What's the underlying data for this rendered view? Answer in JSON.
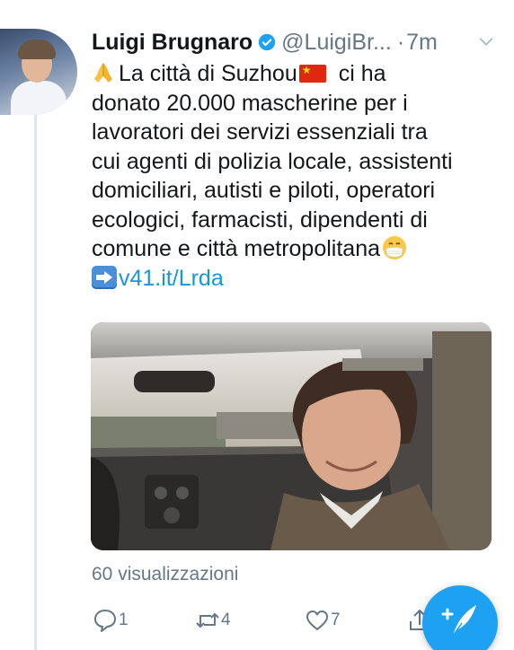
{
  "tweet": {
    "author_name": "Luigi Brugnaro",
    "author_handle": "@LuigiBr...",
    "separator": "·",
    "timestamp": "7m",
    "text_lines": [
      "La città di Suzhou",
      "ci ha",
      "donato 20.000 mascherine per i",
      "lavoratori dei servizi essenziali tra",
      "cui agenti di polizia locale, assistenti",
      "domiciliari, autisti e piloti, operatori",
      "ecologici, farmacisti, dipendenti di",
      "comune e città metropolitana"
    ],
    "link_text": "v41.it/Lrda",
    "views": "60 visualizzazioni"
  },
  "actions": {
    "reply_count": "1",
    "retweet_count": "4",
    "like_count": "7"
  },
  "icons": {
    "verified": "verified-badge-icon",
    "more": "chevron-down-icon",
    "pray": "folded-hands-emoji-icon",
    "flag": "china-flag-emoji-icon",
    "mask": "face-with-medical-mask-emoji-icon",
    "arrow": "right-arrow-emoji-icon",
    "reply": "reply-icon",
    "retweet": "retweet-icon",
    "like": "heart-icon",
    "share": "share-icon",
    "compose": "compose-tweet-icon"
  },
  "colors": {
    "accent": "#1da1f2",
    "link": "#1b95e0",
    "muted": "#657786",
    "text": "#14171a"
  }
}
